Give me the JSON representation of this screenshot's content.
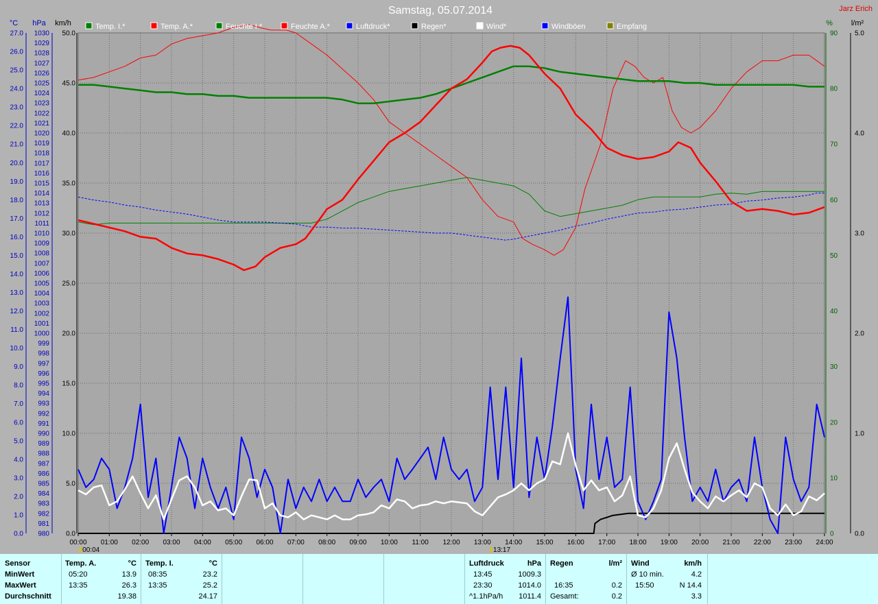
{
  "chart_data": {
    "type": "line",
    "title": "Samstag, 05.07.2014",
    "author": "Jarz Erich",
    "axes": {
      "left_temp": {
        "unit": "°C",
        "min": 0,
        "max": 27,
        "step": 1
      },
      "left_pressure": {
        "unit": "hPa",
        "min": 980,
        "max": 1030,
        "step": 1
      },
      "left_wind": {
        "unit": "km/h",
        "min": 0,
        "max": 50,
        "step": 5
      },
      "right_humidity": {
        "unit": "%",
        "min": 0,
        "max": 90,
        "step": 10
      },
      "right_rain": {
        "unit": "l/m²",
        "min": 0,
        "max": 5,
        "step": 1
      }
    },
    "x_ticks": [
      "00:00",
      "01:00",
      "02:00",
      "03:00",
      "04:00",
      "05:00",
      "06:00",
      "07:00",
      "08:00",
      "09:00",
      "10:00",
      "11:00",
      "12:00",
      "13:00",
      "14:00",
      "15:00",
      "16:00",
      "17:00",
      "18:00",
      "19:00",
      "20:00",
      "21:00",
      "22:00",
      "23:00",
      "24:00"
    ],
    "x_range_hours": [
      0,
      24
    ],
    "markers": [
      {
        "label": "00:04",
        "hour": 0.07
      },
      {
        "label": "13:17",
        "hour": 13.28
      }
    ],
    "grid": true,
    "legend_position": "top",
    "legend": [
      {
        "label": "Temp. I.*",
        "color": "#008000"
      },
      {
        "label": "Temp. A.*",
        "color": "#ff0000"
      },
      {
        "label": "Feuchte I.*",
        "color": "#008000"
      },
      {
        "label": "Feuchte A.*",
        "color": "#ff0000"
      },
      {
        "label": "Luftdruck*",
        "color": "#0000ff"
      },
      {
        "label": "Regen*",
        "color": "#000000"
      },
      {
        "label": "Wind*",
        "color": "#ffffff"
      },
      {
        "label": "Windböen",
        "color": "#0000ff"
      },
      {
        "label": "Empfang",
        "color": "#808000"
      }
    ],
    "series": [
      {
        "name": "Temp. A.*",
        "axis": "left_temp",
        "color": "#ff0000",
        "width": 2.5,
        "x": [
          0,
          0.5,
          1,
          1.5,
          2,
          2.5,
          3,
          3.5,
          4,
          4.5,
          5,
          5.33,
          5.7,
          6,
          6.5,
          7,
          7.3,
          7.7,
          8,
          8.5,
          9,
          9.5,
          10,
          10.5,
          11,
          11.5,
          12,
          12.5,
          13,
          13.3,
          13.58,
          13.9,
          14.2,
          14.5,
          15,
          15.5,
          16,
          16.5,
          17,
          17.5,
          18,
          18.5,
          19,
          19.3,
          19.7,
          20,
          20.5,
          21,
          21.5,
          22,
          22.5,
          23,
          23.5,
          24
        ],
        "y": [
          16.9,
          16.7,
          16.5,
          16.3,
          16.0,
          15.9,
          15.4,
          15.1,
          15.0,
          14.8,
          14.5,
          14.2,
          14.4,
          14.9,
          15.4,
          15.6,
          15.9,
          16.8,
          17.5,
          18.0,
          19.1,
          20.1,
          21.1,
          21.6,
          22.2,
          23.1,
          24.0,
          24.5,
          25.4,
          26.0,
          26.2,
          26.3,
          26.2,
          25.8,
          24.8,
          24.0,
          22.6,
          21.8,
          20.8,
          20.4,
          20.2,
          20.3,
          20.6,
          21.1,
          20.8,
          20.0,
          19.0,
          17.9,
          17.4,
          17.5,
          17.4,
          17.2,
          17.3,
          17.6
        ]
      },
      {
        "name": "Temp. I.*",
        "axis": "left_temp",
        "color": "#008000",
        "width": 2.5,
        "x": [
          0,
          0.5,
          1,
          1.5,
          2,
          2.5,
          3,
          3.5,
          4,
          4.5,
          5,
          5.5,
          6,
          6.5,
          7,
          7.5,
          8,
          8.5,
          9,
          9.5,
          10,
          10.5,
          11,
          11.5,
          12,
          12.5,
          13,
          13.5,
          14,
          14.5,
          15,
          15.5,
          16,
          16.5,
          17,
          17.5,
          18,
          18.5,
          19,
          19.5,
          20,
          20.5,
          21,
          21.5,
          22,
          22.5,
          23,
          23.5,
          24
        ],
        "y": [
          24.2,
          24.2,
          24.1,
          24.0,
          23.9,
          23.8,
          23.8,
          23.7,
          23.7,
          23.6,
          23.6,
          23.5,
          23.5,
          23.5,
          23.5,
          23.5,
          23.5,
          23.4,
          23.2,
          23.2,
          23.3,
          23.4,
          23.5,
          23.7,
          24.0,
          24.3,
          24.6,
          24.9,
          25.2,
          25.2,
          25.1,
          24.9,
          24.8,
          24.7,
          24.6,
          24.5,
          24.4,
          24.4,
          24.4,
          24.3,
          24.3,
          24.2,
          24.2,
          24.2,
          24.2,
          24.2,
          24.2,
          24.1,
          24.1
        ]
      },
      {
        "name": "Feuchte A.*",
        "axis": "right_humidity",
        "color": "#ff0000",
        "width": 1,
        "x": [
          0,
          0.5,
          1,
          1.5,
          2,
          2.5,
          3,
          3.5,
          4,
          4.5,
          5,
          5.5,
          5.8,
          6.2,
          6.7,
          7,
          7.5,
          8,
          8.5,
          9,
          9.5,
          10,
          10.5,
          11,
          11.5,
          12,
          12.5,
          13,
          13.5,
          14,
          14.3,
          14.6,
          15,
          15.3,
          15.6,
          16,
          16.3,
          16.8,
          17.2,
          17.6,
          17.9,
          18.2,
          18.5,
          18.8,
          19.1,
          19.4,
          19.7,
          20,
          20.5,
          21,
          21.5,
          22,
          22.5,
          23,
          23.5,
          24
        ],
        "y": [
          81.5,
          82,
          83,
          84,
          85.5,
          86,
          88,
          89,
          89.5,
          90,
          91,
          91.5,
          91,
          90.5,
          90.5,
          90,
          88,
          86,
          83.5,
          81,
          78,
          74,
          72,
          70,
          68,
          66,
          64,
          60,
          57,
          56,
          53,
          52,
          51,
          50,
          51,
          55,
          62,
          70,
          80,
          85,
          84,
          82,
          81,
          82,
          76,
          73,
          72,
          73,
          76,
          80,
          83,
          85,
          85,
          86,
          86,
          84
        ]
      },
      {
        "name": "Feuchte I.*",
        "axis": "right_humidity",
        "color": "#008000",
        "width": 1,
        "x": [
          0,
          0.5,
          1,
          1.5,
          2,
          3,
          4,
          5,
          6,
          7,
          7.5,
          8,
          8.5,
          9,
          9.5,
          10,
          10.5,
          11,
          11.5,
          12,
          12.5,
          13,
          13.5,
          14,
          14.5,
          15,
          15.5,
          16,
          16.5,
          17,
          17.5,
          18,
          18.5,
          19,
          19.5,
          20,
          20.5,
          21,
          21.5,
          22,
          22.5,
          23,
          23.5,
          24
        ],
        "y": [
          56,
          55.5,
          55.8,
          55.8,
          55.8,
          55.8,
          55.8,
          55.8,
          55.8,
          55.8,
          55.8,
          56.5,
          58,
          59.5,
          60.5,
          61.5,
          62,
          62.5,
          63,
          63.5,
          64,
          63.5,
          63,
          62.5,
          61,
          58,
          57,
          57.5,
          58,
          58.5,
          59,
          60,
          60.5,
          60.5,
          60.5,
          60.5,
          61,
          61.2,
          61,
          61.5,
          61.5,
          61.5,
          61.5,
          61.5
        ]
      },
      {
        "name": "Luftdruck*",
        "axis": "left_pressure",
        "color": "#0000ff",
        "width": 1,
        "dashed": true,
        "x": [
          0,
          0.5,
          1,
          1.5,
          2,
          2.5,
          3,
          3.5,
          4,
          4.5,
          5,
          5.5,
          6,
          6.5,
          7,
          7.5,
          8,
          8.5,
          9,
          9.5,
          10,
          10.5,
          11,
          11.5,
          12,
          12.5,
          13,
          13.5,
          13.75,
          14,
          14.5,
          15,
          15.5,
          16,
          16.5,
          17,
          17.5,
          18,
          18.5,
          19,
          19.5,
          20,
          20.5,
          21,
          21.5,
          22,
          22.5,
          23,
          23.5,
          23.75,
          24
        ],
        "y": [
          1013.6,
          1013.3,
          1013.1,
          1012.8,
          1012.6,
          1012.3,
          1012.1,
          1011.9,
          1011.6,
          1011.3,
          1011.1,
          1011.1,
          1011.1,
          1011.0,
          1010.9,
          1010.6,
          1010.6,
          1010.5,
          1010.5,
          1010.4,
          1010.3,
          1010.2,
          1010.1,
          1010.0,
          1010.0,
          1009.8,
          1009.6,
          1009.4,
          1009.3,
          1009.4,
          1009.7,
          1010.0,
          1010.3,
          1010.7,
          1011.0,
          1011.4,
          1011.7,
          1012.0,
          1012.1,
          1012.3,
          1012.4,
          1012.6,
          1012.8,
          1012.9,
          1013.2,
          1013.3,
          1013.5,
          1013.6,
          1013.8,
          1014.0,
          1014.0
        ]
      },
      {
        "name": "Windböen",
        "axis": "left_wind",
        "color": "#0000ff",
        "width": 2,
        "x": [
          0,
          0.25,
          0.5,
          0.75,
          1,
          1.25,
          1.5,
          1.75,
          2,
          2.25,
          2.5,
          2.75,
          3,
          3.25,
          3.5,
          3.75,
          4,
          4.25,
          4.5,
          4.75,
          5,
          5.25,
          5.5,
          5.75,
          6,
          6.25,
          6.5,
          6.75,
          7,
          7.25,
          7.5,
          7.75,
          8,
          8.25,
          8.5,
          8.75,
          9,
          9.25,
          9.5,
          9.75,
          10,
          10.25,
          10.5,
          10.75,
          11,
          11.25,
          11.5,
          11.75,
          12,
          12.25,
          12.5,
          12.75,
          13,
          13.25,
          13.5,
          13.75,
          14,
          14.25,
          14.5,
          14.75,
          15,
          15.25,
          15.5,
          15.75,
          16,
          16.25,
          16.5,
          16.75,
          17,
          17.25,
          17.5,
          17.75,
          18,
          18.25,
          18.5,
          18.75,
          19,
          19.25,
          19.5,
          19.75,
          20,
          20.25,
          20.5,
          20.75,
          21,
          21.25,
          21.5,
          21.75,
          22,
          22.25,
          22.5,
          22.75,
          23,
          23.25,
          23.5,
          23.75,
          24
        ],
        "y": [
          6.4,
          4.6,
          5.4,
          7.5,
          6.4,
          2.5,
          4.6,
          7.5,
          12.9,
          3.6,
          7.5,
          0,
          4.6,
          9.6,
          7.5,
          2.5,
          7.5,
          4.6,
          2.5,
          4.6,
          1.4,
          9.6,
          7.5,
          3.6,
          6.4,
          4.6,
          0,
          5.4,
          2.5,
          4.6,
          3.2,
          5.4,
          3.2,
          4.6,
          3.2,
          3.2,
          5.4,
          3.6,
          4.6,
          5.4,
          3.2,
          7.5,
          5.4,
          6.4,
          7.5,
          8.6,
          5.4,
          9.6,
          6.4,
          5.4,
          6.4,
          3.2,
          4.6,
          14.6,
          5.4,
          14.6,
          4.6,
          17.5,
          3.6,
          9.6,
          5.4,
          10.7,
          17.5,
          23.6,
          6.4,
          2.5,
          12.9,
          5.4,
          9.6,
          4.6,
          5.4,
          14.6,
          3.2,
          1.4,
          3.2,
          5.4,
          22.1,
          17.5,
          9.6,
          3.2,
          4.6,
          3.2,
          6.4,
          3.2,
          4.6,
          5.4,
          3.2,
          9.6,
          4.6,
          1.4,
          0,
          9.6,
          5.4,
          3.2,
          4.6,
          12.9,
          9.6
        ]
      },
      {
        "name": "Wind*",
        "axis": "left_wind",
        "color": "#ffffff",
        "width": 2.5,
        "x": [
          0,
          0.25,
          0.5,
          0.75,
          1,
          1.25,
          1.5,
          1.75,
          2,
          2.25,
          2.5,
          2.75,
          3,
          3.25,
          3.5,
          3.75,
          4,
          4.25,
          4.5,
          4.75,
          5,
          5.25,
          5.5,
          5.75,
          6,
          6.25,
          6.5,
          6.75,
          7,
          7.25,
          7.5,
          7.75,
          8,
          8.25,
          8.5,
          8.75,
          9,
          9.25,
          9.5,
          9.75,
          10,
          10.25,
          10.5,
          10.75,
          11,
          11.25,
          11.5,
          11.75,
          12,
          12.25,
          12.5,
          12.75,
          13,
          13.25,
          13.5,
          13.75,
          14,
          14.25,
          14.5,
          14.75,
          15,
          15.25,
          15.5,
          15.75,
          16,
          16.25,
          16.5,
          16.75,
          17,
          17.25,
          17.5,
          17.75,
          18,
          18.25,
          18.5,
          18.75,
          19,
          19.25,
          19.5,
          19.75,
          20,
          20.25,
          20.5,
          20.75,
          21,
          21.25,
          21.5,
          21.75,
          22,
          22.25,
          22.5,
          22.75,
          23,
          23.25,
          23.5,
          23.75,
          24
        ],
        "y": [
          4.3,
          3.9,
          4.6,
          4.8,
          2.8,
          3.2,
          4.4,
          5.7,
          4.0,
          2.5,
          3.8,
          1.4,
          3.4,
          5.3,
          5.7,
          4.6,
          2.8,
          3.2,
          2.3,
          2.5,
          1.8,
          3.7,
          5.4,
          5.3,
          2.5,
          3.0,
          1.8,
          1.6,
          2.1,
          1.4,
          1.8,
          1.6,
          1.4,
          1.8,
          1.4,
          1.4,
          1.8,
          1.9,
          2.1,
          2.8,
          2.5,
          3.4,
          3.2,
          2.5,
          2.8,
          2.9,
          3.2,
          3.0,
          3.2,
          3.1,
          3.0,
          2.2,
          1.8,
          2.7,
          3.6,
          3.9,
          4.3,
          5.0,
          4.3,
          5.0,
          5.4,
          7.2,
          6.9,
          10.0,
          6.8,
          4.3,
          5.3,
          4.3,
          4.6,
          3.2,
          3.8,
          5.7,
          1.8,
          1.6,
          2.5,
          4.3,
          7.5,
          9.0,
          6.4,
          4.1,
          3.2,
          2.5,
          3.7,
          3.2,
          3.8,
          4.3,
          3.6,
          5.0,
          4.6,
          2.5,
          1.8,
          2.9,
          1.8,
          2.2,
          3.7,
          3.3,
          4.0
        ]
      },
      {
        "name": "Regen*",
        "axis": "right_rain",
        "color": "#000000",
        "width": 2,
        "x": [
          0,
          16.5,
          16.58,
          16.62,
          16.8,
          17.2,
          17.7,
          18.2,
          24
        ],
        "y": [
          0,
          0,
          0,
          0.1,
          0.14,
          0.18,
          0.2,
          0.2,
          0.2
        ]
      }
    ]
  },
  "stats": {
    "sensor": {
      "header": "Sensor",
      "rows": [
        "MinWert",
        "MaxWert",
        "Durchschnitt"
      ]
    },
    "temp_a": {
      "header": "Temp. A.",
      "unit": "°C",
      "times": [
        "05:20",
        "13:35"
      ],
      "values": [
        "13.9",
        "26.3",
        "19.38"
      ]
    },
    "temp_i": {
      "header": "Temp. I.",
      "unit": "°C",
      "times": [
        "08:35",
        "13:35"
      ],
      "values": [
        "23.2",
        "25.2",
        "24.17"
      ]
    },
    "pressure": {
      "header": "Luftdruck",
      "unit": "hPa",
      "times": [
        "13:45",
        "23:30",
        "^1.1hPa/h"
      ],
      "values": [
        "1009.3",
        "1014.0",
        "1011.4"
      ]
    },
    "rain": {
      "header": "Regen",
      "unit": "l/m²",
      "times": [
        "",
        "16:35",
        "Gesamt:"
      ],
      "values": [
        "",
        "0.2",
        "0.2"
      ]
    },
    "wind": {
      "header": "Wind",
      "unit": "km/h",
      "times": [
        "Ø 10 min.",
        "15:50"
      ],
      "values": [
        "4.2",
        "N 14.4",
        "3.3"
      ]
    }
  }
}
